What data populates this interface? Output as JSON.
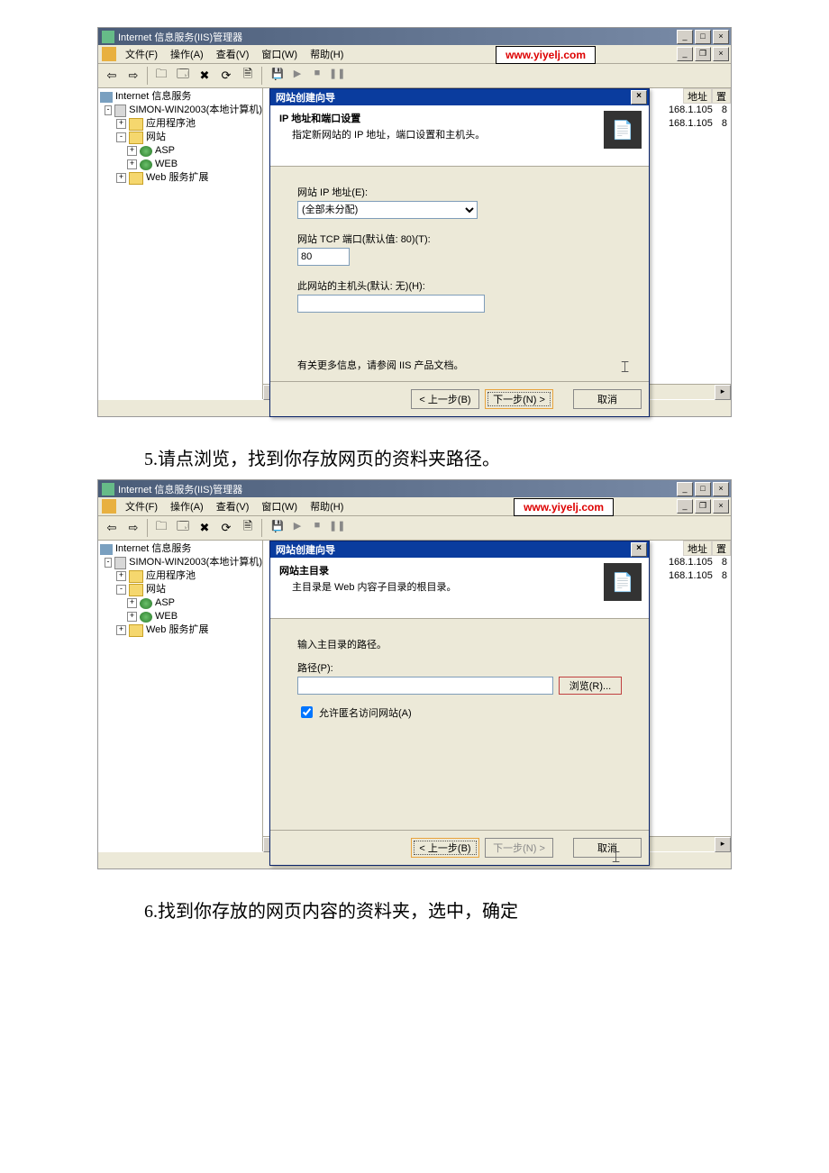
{
  "step5_text": "5.请点浏览，找到你存放网页的资料夹路径。",
  "step6_text": "6.找到你存放的网页内容的资料夹，选中，确定",
  "app_title": "Internet 信息服务(IIS)管理器",
  "url_overlay": "www.yiyelj.com",
  "menu": {
    "file": "文件(F)",
    "action": "操作(A)",
    "view": "查看(V)",
    "window": "窗口(W)",
    "help": "帮助(H)"
  },
  "tree": {
    "root": "Internet 信息服务",
    "server": "SIMON-WIN2003(本地计算机)",
    "apppool": "应用程序池",
    "sites": "网站",
    "asp": "ASP",
    "web": "WEB",
    "webext": "Web 服务扩展"
  },
  "right": {
    "h_addr": "地址",
    "h_op": "置",
    "ip1": "168.1.105",
    "ip2": "168.1.105",
    "op": "8"
  },
  "wizard1": {
    "title": "网站创建向导",
    "head": "IP 地址和端口设置",
    "sub": "指定新网站的 IP 地址，端口设置和主机头。",
    "lbl_ip": "网站 IP 地址(E):",
    "ip_value": "(全部未分配)",
    "lbl_port": "网站 TCP 端口(默认值: 80)(T):",
    "port_value": "80",
    "lbl_host": "此网站的主机头(默认: 无)(H):",
    "info": "有关更多信息，请参阅 IIS 产品文档。",
    "back": "< 上一步(B)",
    "next": "下一步(N) >",
    "cancel": "取消"
  },
  "wizard2": {
    "title": "网站创建向导",
    "head": "网站主目录",
    "sub": "主目录是 Web 内容子目录的根目录。",
    "lbl_enter": "输入主目录的路径。",
    "lbl_path": "路径(P):",
    "browse": "浏览(R)...",
    "chk_anon": "允许匿名访问网站(A)",
    "back": "< 上一步(B)",
    "next": "下一步(N) >",
    "cancel": "取消"
  }
}
